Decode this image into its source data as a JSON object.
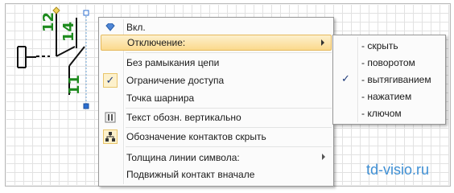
{
  "canvas": {
    "shape_numbers": [
      "12",
      "14",
      "11"
    ],
    "grid_color": "#e2e2e2",
    "label_color": "#1d8a1d"
  },
  "context_menu": {
    "items": [
      {
        "label": "Вкл.",
        "icon": "diamond-icon"
      },
      {
        "label": "Отключение:",
        "submenu": true,
        "highlighted": true
      },
      {
        "label": "Без рамыкания цепи"
      },
      {
        "label": "Ограничение доступа",
        "checked": true
      },
      {
        "label": "Точка шарнира"
      },
      {
        "label": "Текст обозн. вертикально",
        "icon": "vertical-text-icon"
      },
      {
        "label": "Обозначение контактов скрыть",
        "icon": "hierarchy-icon"
      },
      {
        "label": "Толщина линии символа:",
        "submenu": true
      },
      {
        "label": "Подвижный контакт вначале"
      }
    ],
    "check_glyph": "✓"
  },
  "submenu": {
    "items": [
      {
        "label": "- скрыть"
      },
      {
        "label": "- поворотом"
      },
      {
        "label": "- вытягиванием",
        "checked": true
      },
      {
        "label": "- нажатием"
      },
      {
        "label": "- ключом"
      }
    ]
  },
  "watermark": "td-visio.ru"
}
